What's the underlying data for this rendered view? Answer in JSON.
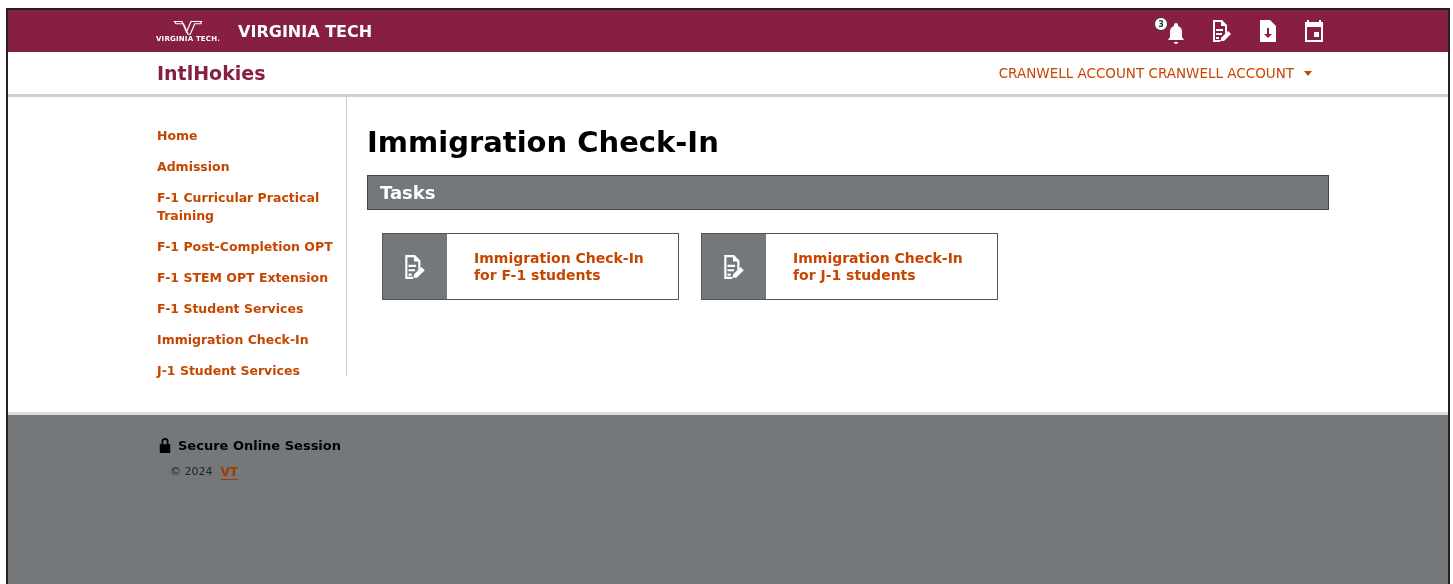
{
  "header": {
    "logo_caption": "VIRGINIA TECH.",
    "brand": "VIRGINIA TECH",
    "notification_count": "3"
  },
  "subheader": {
    "site_title": "IntlHokies",
    "account": "CRANWELL ACCOUNT CRANWELL ACCOUNT"
  },
  "sidebar": {
    "items": [
      {
        "label": "Home"
      },
      {
        "label": "Admission"
      },
      {
        "label": "F-1 Curricular Practical Training"
      },
      {
        "label": "F-1 Post-Completion OPT"
      },
      {
        "label": "F-1 STEM OPT Extension"
      },
      {
        "label": "F-1 Student Services"
      },
      {
        "label": "Immigration Check-In"
      },
      {
        "label": "J-1 Student Services"
      }
    ]
  },
  "main": {
    "title": "Immigration Check-In",
    "section": "Tasks",
    "tasks": [
      {
        "line1": "Immigration Check-In",
        "line2": "for F-1 students"
      },
      {
        "line1": "Immigration Check-In",
        "line2": "for J-1 students"
      }
    ]
  },
  "footer": {
    "secure": "Secure Online Session",
    "copyright": "© 2024",
    "link": "VT"
  }
}
